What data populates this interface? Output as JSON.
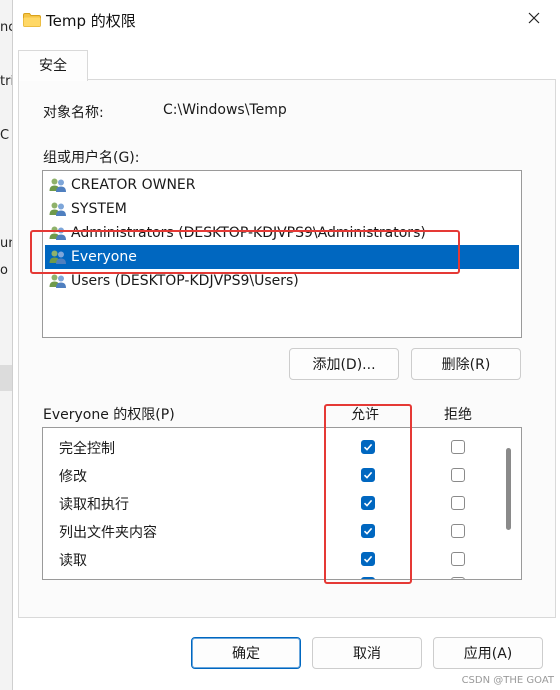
{
  "background_window": {
    "fragments": [
      "nc",
      "tri",
      "C",
      "um",
      "o"
    ]
  },
  "dialog": {
    "title": "Temp 的权限",
    "icons": {
      "title": "folder-icon",
      "close": "close-icon"
    },
    "tab": "安全",
    "object_name_label": "对象名称:",
    "object_name_value": "C:\\Windows\\Temp",
    "group_label": "组或用户名(G):",
    "users": [
      {
        "name": "CREATOR OWNER",
        "icon": "user-group-icon",
        "selected": false
      },
      {
        "name": "SYSTEM",
        "icon": "user-group-icon",
        "selected": false
      },
      {
        "name": "Administrators (DESKTOP-KDJVPS9\\Administrators)",
        "icon": "user-group-icon",
        "selected": false
      },
      {
        "name": "Everyone",
        "icon": "user-group-icon",
        "selected": true
      },
      {
        "name": "Users (DESKTOP-KDJVPS9\\Users)",
        "icon": "user-group-icon",
        "selected": false
      }
    ],
    "add_button": "添加(D)...",
    "remove_button": "删除(R)",
    "permissions_label": "Everyone 的权限(P)",
    "allow_header": "允许",
    "deny_header": "拒绝",
    "permissions": [
      {
        "name": "完全控制",
        "allow": true,
        "deny": false
      },
      {
        "name": "修改",
        "allow": true,
        "deny": false
      },
      {
        "name": "读取和执行",
        "allow": true,
        "deny": false
      },
      {
        "name": "列出文件夹内容",
        "allow": true,
        "deny": false
      },
      {
        "name": "读取",
        "allow": true,
        "deny": false
      }
    ],
    "ok_button": "确定",
    "cancel_button": "取消",
    "apply_button": "应用(A)"
  },
  "colors": {
    "accent": "#0067c0",
    "highlight": "#e53935"
  },
  "watermark": "CSDN @THE GOAT"
}
